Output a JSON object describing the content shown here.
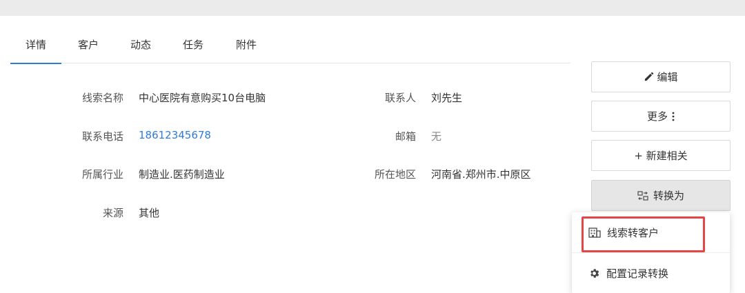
{
  "tabs": [
    "详情",
    "客户",
    "动态",
    "任务",
    "附件"
  ],
  "fields": {
    "lead_name": {
      "label": "线索名称",
      "value": "中心医院有意购买10台电脑"
    },
    "contact": {
      "label": "联系人",
      "value": "刘先生"
    },
    "phone": {
      "label": "联系电话",
      "value": "18612345678"
    },
    "email": {
      "label": "邮箱",
      "value": "无"
    },
    "industry": {
      "label": "所属行业",
      "value": "制造业.医药制造业"
    },
    "region": {
      "label": "所在地区",
      "value": "河南省.郑州市.中原区"
    },
    "source": {
      "label": "来源",
      "value": "其他"
    }
  },
  "actions": {
    "edit": "编辑",
    "more": "更多",
    "new_related": "+ 新建相关",
    "convert": "转换为"
  },
  "dropdown": {
    "to_customer": "线索转客户",
    "config_conversion": "配置记录转换"
  },
  "icons": [
    "pencil-icon",
    "vertical-ellipsis-icon",
    "convert-icon",
    "building-icon",
    "gear-icon"
  ],
  "colors": {
    "accent": "#2e7cd6",
    "highlight": "#e64545"
  }
}
